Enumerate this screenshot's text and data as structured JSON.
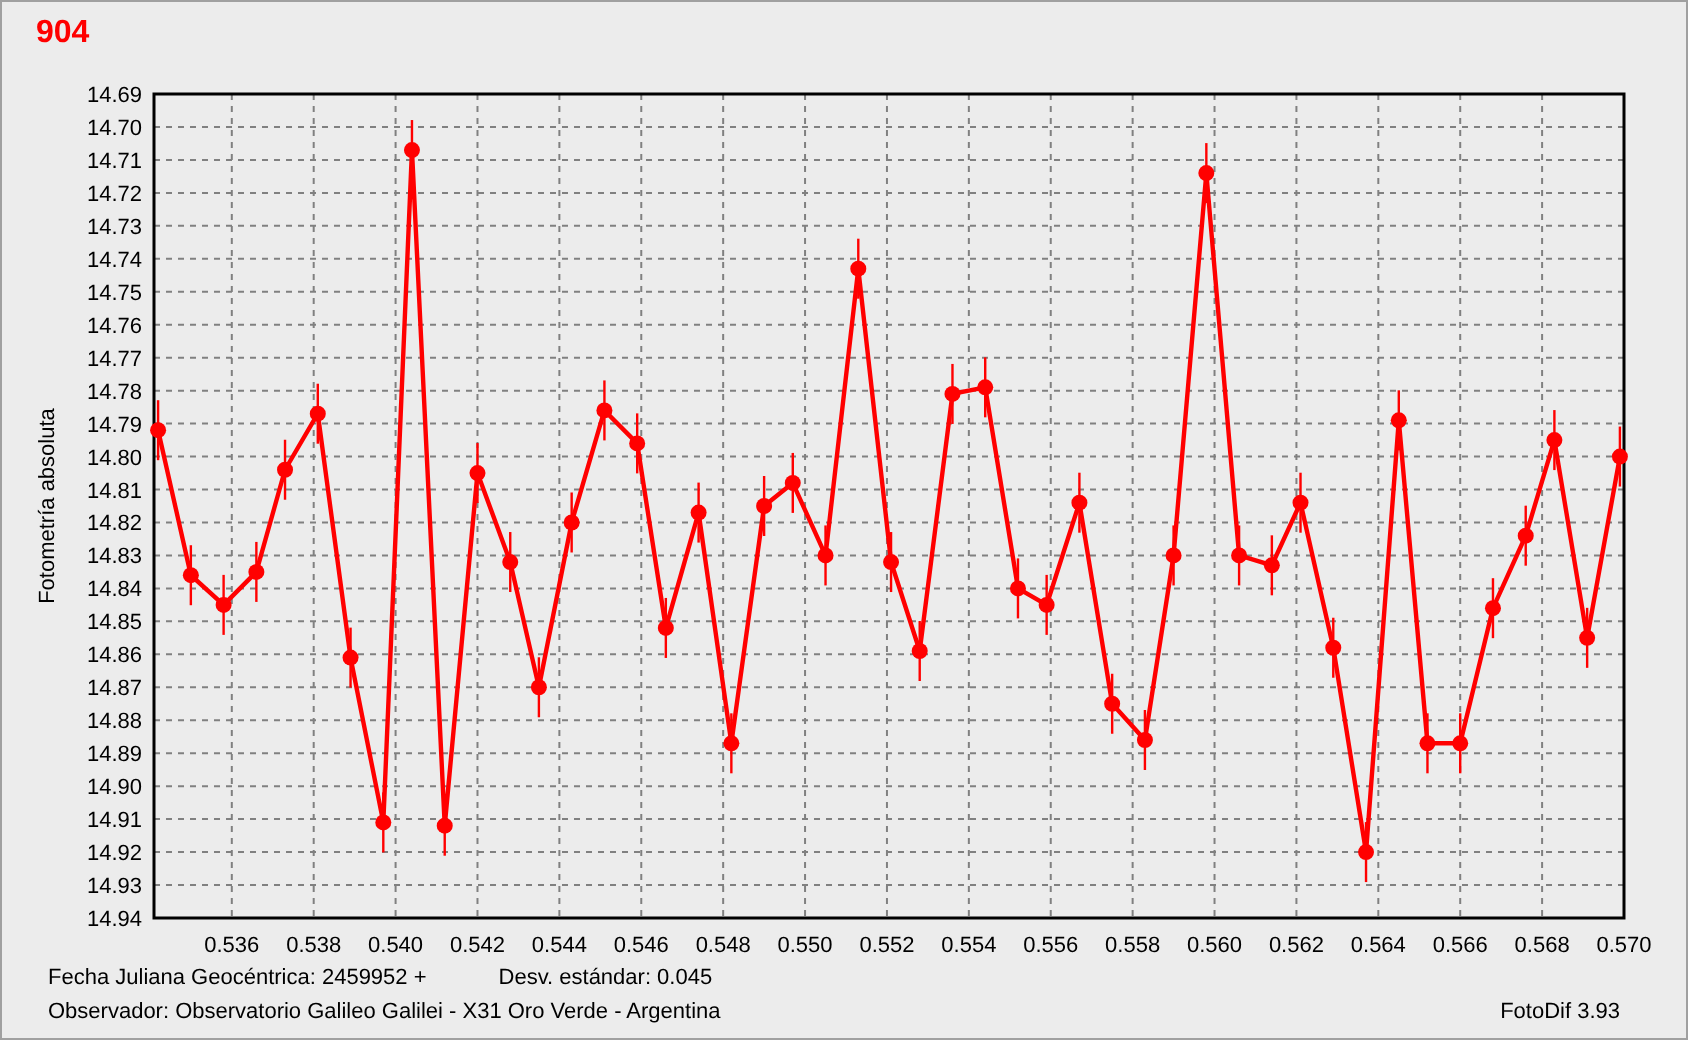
{
  "chart": {
    "chart_data": {
      "type": "line",
      "grid": true,
      "ylabel": "Fotometría absoluta",
      "x": [
        0.5342,
        0.535,
        0.5358,
        0.5366,
        0.5373,
        0.5381,
        0.5389,
        0.5397,
        0.5404,
        0.5412,
        0.542,
        0.5428,
        0.5435,
        0.5443,
        0.5451,
        0.5459,
        0.5466,
        0.5474,
        0.5482,
        0.549,
        0.5497,
        0.5505,
        0.5513,
        0.5521,
        0.5528,
        0.5536,
        0.5544,
        0.5552,
        0.5559,
        0.5567,
        0.5575,
        0.5583,
        0.559,
        0.5598,
        0.5606,
        0.5614,
        0.5621,
        0.5629,
        0.5637,
        0.5645,
        0.5652,
        0.566,
        0.5668,
        0.5676,
        0.5683,
        0.5691,
        0.5699
      ],
      "series": [
        {
          "name": "904",
          "color": "#ff0000",
          "marker": "circle",
          "values": [
            14.792,
            14.836,
            14.845,
            14.835,
            14.804,
            14.787,
            14.861,
            14.911,
            14.707,
            14.912,
            14.805,
            14.832,
            14.87,
            14.82,
            14.786,
            14.796,
            14.852,
            14.817,
            14.887,
            14.815,
            14.808,
            14.83,
            14.743,
            14.832,
            14.859,
            14.781,
            14.779,
            14.84,
            14.845,
            14.814,
            14.875,
            14.886,
            14.83,
            14.714,
            14.83,
            14.833,
            14.814,
            14.858,
            14.92,
            14.789,
            14.887,
            14.887,
            14.846,
            14.824,
            14.795,
            14.855,
            14.8
          ]
        }
      ],
      "xlim": [
        0.5341,
        0.57
      ],
      "ylim": [
        14.94,
        14.69
      ],
      "xticks": [
        {
          "value": 0.536,
          "label": "0.536"
        },
        {
          "value": 0.538,
          "label": "0.538"
        },
        {
          "value": 0.54,
          "label": "0.540"
        },
        {
          "value": 0.542,
          "label": "0.542"
        },
        {
          "value": 0.544,
          "label": "0.544"
        },
        {
          "value": 0.546,
          "label": "0.546"
        },
        {
          "value": 0.548,
          "label": "0.548"
        },
        {
          "value": 0.55,
          "label": "0.550"
        },
        {
          "value": 0.552,
          "label": "0.552"
        },
        {
          "value": 0.554,
          "label": "0.554"
        },
        {
          "value": 0.556,
          "label": "0.556"
        },
        {
          "value": 0.558,
          "label": "0.558"
        },
        {
          "value": 0.56,
          "label": "0.560"
        },
        {
          "value": 0.562,
          "label": "0.562"
        },
        {
          "value": 0.564,
          "label": "0.564"
        },
        {
          "value": 0.566,
          "label": "0.566"
        },
        {
          "value": 0.568,
          "label": "0.568"
        },
        {
          "value": 0.57,
          "label": "0.570"
        }
      ],
      "yticks": [
        {
          "value": 14.69,
          "label": "14.69"
        },
        {
          "value": 14.7,
          "label": "14.70"
        },
        {
          "value": 14.71,
          "label": "14.71"
        },
        {
          "value": 14.72,
          "label": "14.72"
        },
        {
          "value": 14.73,
          "label": "14.73"
        },
        {
          "value": 14.74,
          "label": "14.74"
        },
        {
          "value": 14.75,
          "label": "14.75"
        },
        {
          "value": 14.76,
          "label": "14.76"
        },
        {
          "value": 14.77,
          "label": "14.77"
        },
        {
          "value": 14.78,
          "label": "14.78"
        },
        {
          "value": 14.79,
          "label": "14.79"
        },
        {
          "value": 14.8,
          "label": "14.80"
        },
        {
          "value": 14.81,
          "label": "14.81"
        },
        {
          "value": 14.82,
          "label": "14.82"
        },
        {
          "value": 14.83,
          "label": "14.83"
        },
        {
          "value": 14.84,
          "label": "14.84"
        },
        {
          "value": 14.85,
          "label": "14.85"
        },
        {
          "value": 14.86,
          "label": "14.86"
        },
        {
          "value": 14.87,
          "label": "14.87"
        },
        {
          "value": 14.88,
          "label": "14.88"
        },
        {
          "value": 14.89,
          "label": "14.89"
        },
        {
          "value": 14.9,
          "label": "14.90"
        },
        {
          "value": 14.91,
          "label": "14.91"
        },
        {
          "value": 14.92,
          "label": "14.92"
        },
        {
          "value": 14.93,
          "label": "14.93"
        },
        {
          "value": 14.94,
          "label": "14.94"
        }
      ]
    }
  },
  "footer": {
    "julian_date": "Fecha Juliana Geocéntrica: 2459952 +",
    "std_dev": "Desv. estándar: 0.045",
    "observer": "Observador: Observatorio Galileo Galilei - X31 Oro Verde - Argentina",
    "version": "FotoDif 3.93"
  }
}
